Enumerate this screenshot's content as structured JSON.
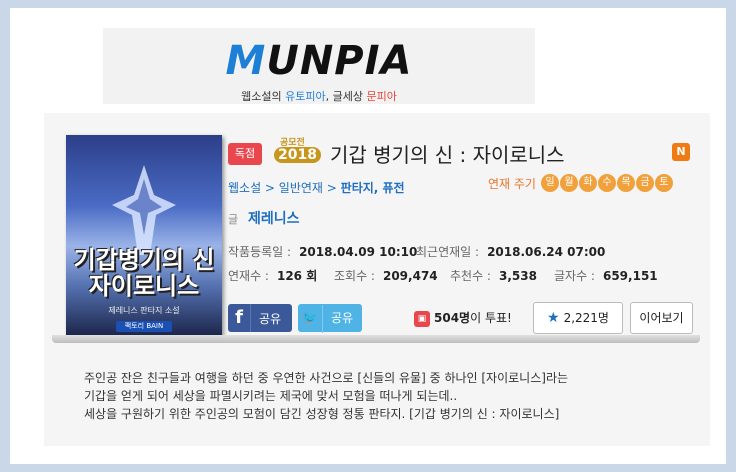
{
  "logo": {
    "wordmark_m": "M",
    "wordmark_rest": "UNPIA",
    "subtitle_prefix": "웹소설의 ",
    "subtitle_hl1": "유토피아",
    "subtitle_mid": ", 글세상 ",
    "subtitle_hl2": "문피아"
  },
  "cover": {
    "title_line1": "기갑병기의 신",
    "title_line2": "자이로니스",
    "sub": "제레니스 판타지 소설",
    "badge": "팩토리 BAIN"
  },
  "badges": {
    "exclusive": "독점",
    "contest_top": "공모전",
    "contest_year": "2018",
    "new": "N"
  },
  "title": "기갑 병기의 신 : 자이로니스",
  "genre": {
    "breadcrumb": "웹소설 > 일반연재 > ",
    "tags": "판타지, 퓨전"
  },
  "serial": {
    "label": "연재 주기",
    "days": [
      "일",
      "월",
      "화",
      "수",
      "목",
      "금",
      "토"
    ]
  },
  "author": {
    "prefix": "글",
    "name": "제레니스"
  },
  "stats": {
    "registered_label": "작품등록일 :",
    "registered_value": "2018.04.09 10:10",
    "latest_label": "최근연재일 :",
    "latest_value": "2018.06.24 07:00",
    "episodes_label": "연재수 :",
    "episodes_value": "126 회",
    "views_label": "조회수 :",
    "views_value": "209,474",
    "recommend_label": "추천수 :",
    "recommend_value": "3,538",
    "chars_label": "글자수 :",
    "chars_value": "659,151"
  },
  "actions": {
    "facebook_icon": "f",
    "facebook_label": "공유",
    "twitter_label": "공유",
    "vote_count": "504명",
    "vote_suffix": "이 투표!",
    "favorites": "2,221명",
    "continue": "이어보기"
  },
  "description": [
    "주인공 잔은 친구들과 여행을 하던 중 우연한 사건으로 [신들의 유물] 중 하나인 [자이로니스]라는",
    "기갑을 얻게 되어 세상을 파멸시키려는 제국에 맞서 모험을 떠나게 되는데..",
    "세상을 구원하기 위한 주인공의 모험이 담긴 성장형 정통 판타지. [기갑 병기의 신 : 자이로니스]"
  ],
  "colors": {
    "background": "#c9d7e8",
    "link_blue": "#1e6fbf",
    "serial_orange": "#e8742a",
    "day_orange": "#f0a13c",
    "exclusive_red": "#e8474e",
    "new_orange": "#f07a14",
    "facebook": "#3b5998",
    "twitter": "#4fb3e6"
  },
  "icons": {
    "facebook": "facebook-icon",
    "twitter": "twitter-bird-icon",
    "vote": "ballot-box-icon",
    "favorite": "star-icon"
  }
}
